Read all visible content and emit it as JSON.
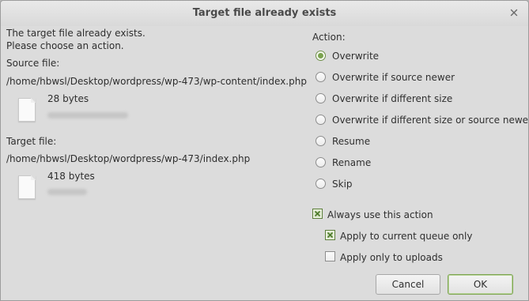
{
  "window": {
    "title": "Target file already exists",
    "close_symbol": "×"
  },
  "message": {
    "line1": "The target file already exists.",
    "line2": "Please choose an action."
  },
  "source": {
    "label": "Source file:",
    "path": "/home/hbwsl/Desktop/wordpress/wp-473/wp-content/index.php",
    "size": "28 bytes"
  },
  "target": {
    "label": "Target file:",
    "path": "/home/hbwsl/Desktop/wordpress/wp-473/index.php",
    "size": "418 bytes"
  },
  "action": {
    "label": "Action:",
    "options": [
      {
        "label": "Overwrite",
        "selected": true
      },
      {
        "label": "Overwrite if source newer",
        "selected": false
      },
      {
        "label": "Overwrite if different size",
        "selected": false
      },
      {
        "label": "Overwrite if different size or source newer",
        "selected": false
      },
      {
        "label": "Resume",
        "selected": false
      },
      {
        "label": "Rename",
        "selected": false
      },
      {
        "label": "Skip",
        "selected": false
      }
    ]
  },
  "options": {
    "always_use": {
      "label": "Always use this action",
      "checked": true
    },
    "current_queue_only": {
      "label": "Apply to current queue only",
      "checked": true
    },
    "uploads_only": {
      "label": "Apply only to uploads",
      "checked": false
    }
  },
  "buttons": {
    "cancel": "Cancel",
    "ok": "OK"
  },
  "colors": {
    "accent": "#7aa24e",
    "dialog_bg": "#dcdcdc"
  },
  "icons": {
    "close": "close-icon",
    "file": "file-icon",
    "check": "check-icon"
  }
}
